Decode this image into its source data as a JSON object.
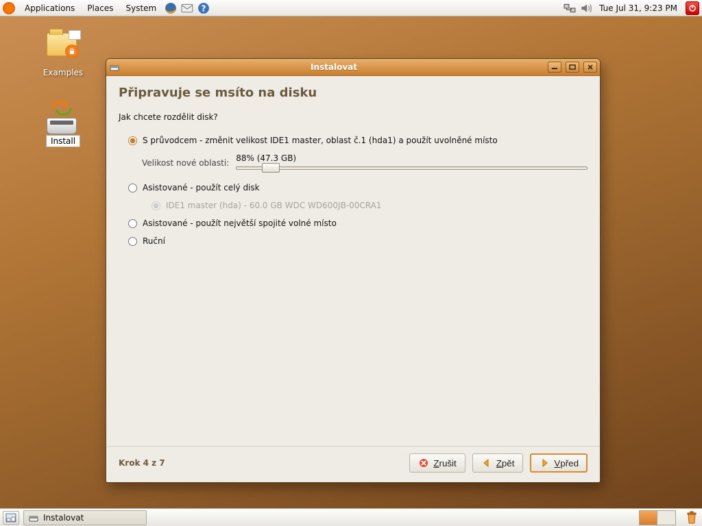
{
  "panel": {
    "menus": [
      "Applications",
      "Places",
      "System"
    ],
    "clock": "Tue Jul 31,  9:23 PM"
  },
  "desktop": {
    "examples_label": "Examples",
    "install_label": "Install"
  },
  "dialog": {
    "title": "Instalovat",
    "heading": "Připravuje se msíto na disku",
    "question": "Jak chcete  rozdělit disk?",
    "options": {
      "guided_resize": "S průvodcem - změnit velikost IDE1 master, oblast č.1 (hda1) a použít uvolněné místo",
      "resize_label": "Velikost nové oblasti:",
      "resize_readout": "88% (47.3 GB)",
      "resize_percent": 10,
      "guided_whole": "Asistované - použít celý disk",
      "disk_device": "IDE1 master (hda) - 60.0 GB WDC WD600JB-00CRA1",
      "guided_free": "Asistované - použít největší spojité volné místo",
      "manual": "Ruční"
    },
    "step": "Krok 4 z 7",
    "buttons": {
      "cancel": "Zrušit",
      "back": "Zpět",
      "forward": "Vpřed"
    }
  },
  "taskbar": {
    "task1": "Instalovat"
  }
}
